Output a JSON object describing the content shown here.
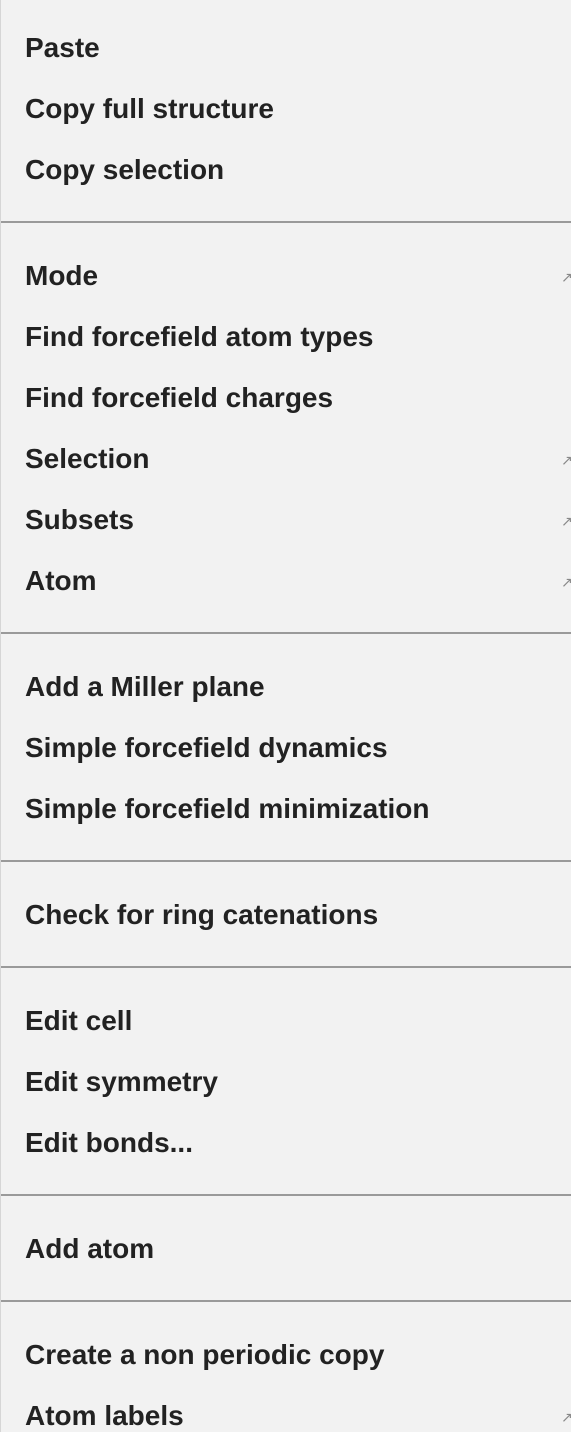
{
  "menu": {
    "groups": [
      {
        "items": [
          {
            "label": "Paste",
            "submenu": false
          },
          {
            "label": "Copy full structure",
            "submenu": false
          },
          {
            "label": "Copy selection",
            "submenu": false
          }
        ]
      },
      {
        "items": [
          {
            "label": "Mode",
            "submenu": true
          },
          {
            "label": "Find forcefield atom types",
            "submenu": false
          },
          {
            "label": "Find forcefield charges",
            "submenu": false
          },
          {
            "label": "Selection",
            "submenu": true
          },
          {
            "label": "Subsets",
            "submenu": true
          },
          {
            "label": "Atom",
            "submenu": true
          }
        ]
      },
      {
        "items": [
          {
            "label": "Add a Miller plane",
            "submenu": false
          },
          {
            "label": "Simple forcefield dynamics",
            "submenu": false
          },
          {
            "label": "Simple forcefield minimization",
            "submenu": false
          }
        ]
      },
      {
        "items": [
          {
            "label": "Check for ring catenations",
            "submenu": false
          }
        ]
      },
      {
        "items": [
          {
            "label": "Edit cell",
            "submenu": false
          },
          {
            "label": "Edit symmetry",
            "submenu": false
          },
          {
            "label": "Edit bonds...",
            "submenu": false
          }
        ]
      },
      {
        "items": [
          {
            "label": "Add atom",
            "submenu": false
          }
        ]
      },
      {
        "items": [
          {
            "label": "Create a non periodic copy",
            "submenu": false
          },
          {
            "label": "Atom labels",
            "submenu": true
          }
        ]
      }
    ],
    "submenu_icon": "chevron-right-icon",
    "colors": {
      "background": "#f2f2f2",
      "text": "#222222",
      "separator": "#9a9a9a"
    }
  }
}
